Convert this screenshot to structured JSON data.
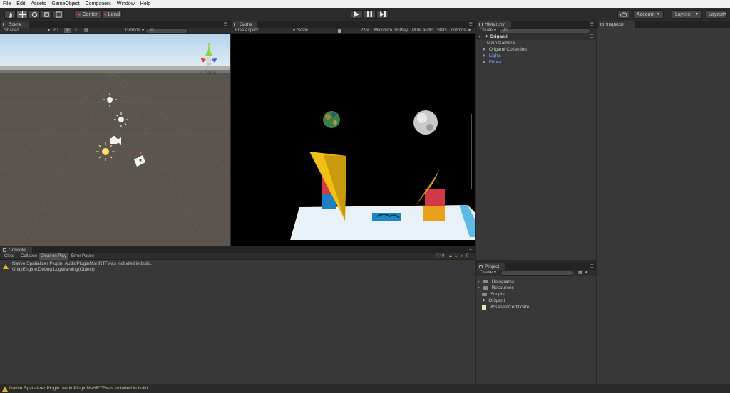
{
  "menu": [
    "File",
    "Edit",
    "Assets",
    "GameObject",
    "Component",
    "Window",
    "Help"
  ],
  "toolbar": {
    "pivot_label": "Center",
    "space_label": "Local",
    "account_label": "Account",
    "layers_label": "Layers",
    "layout_label": "Layout"
  },
  "scene": {
    "tab_label": "Scene",
    "shading_label": "Shaded",
    "mode_2d": "2D",
    "gizmos_label": "Gizmos",
    "search_placeholder": "All",
    "persp_label": "< Persp"
  },
  "game": {
    "tab_label": "Game",
    "aspect_label": "Free Aspect",
    "scale_label": "Scale",
    "scale_value": "2.9x",
    "scale_fraction": 0.6,
    "maximize_label": "Maximize on Play",
    "mute_label": "Mute audio",
    "stats_label": "Stats",
    "gizmos_label": "Gizmos"
  },
  "hierarchy": {
    "tab_label": "Hierarchy",
    "create_label": "Create",
    "search_placeholder": "All",
    "root": "Origami",
    "items": [
      "Main Camera",
      "Origami Collection",
      "Lights",
      "FItbox"
    ]
  },
  "inspector": {
    "tab_label": "Inspector"
  },
  "console": {
    "tab_label": "Console",
    "buttons": [
      "Clear",
      "Collapse",
      "Clear on Play",
      "Error Pause"
    ],
    "info_count": "0",
    "warn_count": "1",
    "error_count": "0",
    "message_line1": "Native Spatializer Plugin: AudioPluginMsHRTFwas included in build.",
    "message_line2": "UnityEngine.Debug:LogWarning(Object)"
  },
  "project": {
    "tab_label": "Project",
    "create_label": "Create",
    "items": [
      "Holograms",
      "Resources",
      "Scripts",
      "Origami",
      "WSATestCertificate"
    ]
  },
  "status": {
    "message": "Native Spatializer Plugin: AudioPluginMsHRTFwas included in build."
  }
}
